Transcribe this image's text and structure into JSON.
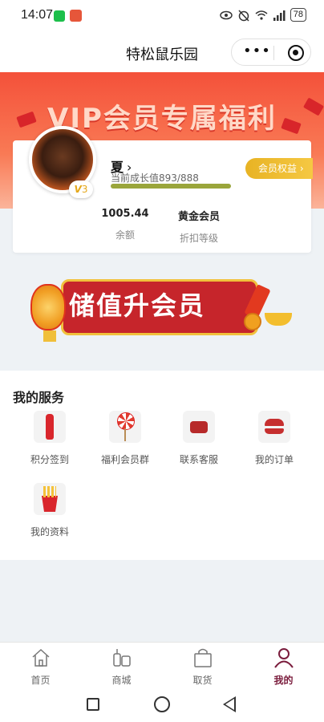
{
  "status_bar": {
    "time": "14:07",
    "battery": "78"
  },
  "nav": {
    "title": "特松鼠乐园"
  },
  "banner": {
    "text": "VIP会员专属福利"
  },
  "member": {
    "name": "夏",
    "chevron": "›",
    "growth_label": "当前成长值893/888",
    "growth_fraction": 1.0,
    "level_badge": "3",
    "level_v": "V",
    "benefit_button": "会员权益 ›",
    "stats": [
      {
        "value": "1005.44",
        "label": "余额"
      },
      {
        "value": "黄金会员",
        "label": "折扣等级"
      }
    ]
  },
  "promo": {
    "text": "储值升会员"
  },
  "services": {
    "title": "我的服务",
    "items": [
      {
        "label": "积分签到",
        "icon": "cola-icon"
      },
      {
        "label": "福利会员群",
        "icon": "lollipop-icon"
      },
      {
        "label": "联系客服",
        "icon": "telephone-icon"
      },
      {
        "label": "我的订单",
        "icon": "burger-icon"
      },
      {
        "label": "我的资料",
        "icon": "fries-icon"
      }
    ]
  },
  "tabbar": {
    "items": [
      {
        "label": "首页",
        "icon": "home-icon"
      },
      {
        "label": "商城",
        "icon": "shop-icon"
      },
      {
        "label": "取货",
        "icon": "bag-icon"
      },
      {
        "label": "我的",
        "icon": "user-icon",
        "active": true
      }
    ],
    "active_color": "#7a1c3c"
  }
}
